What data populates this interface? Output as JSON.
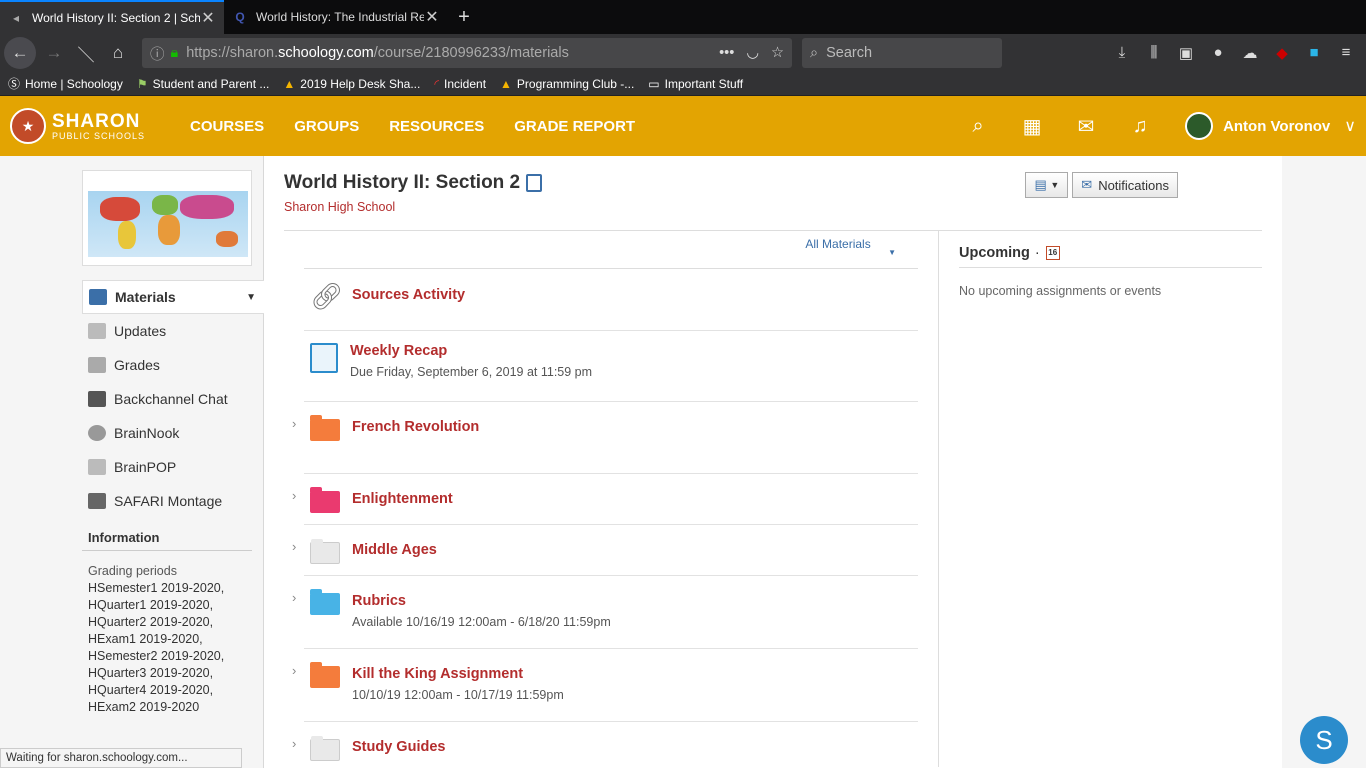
{
  "browser": {
    "tabs": [
      {
        "title": "World History II: Section 2 | Sch",
        "active": true
      },
      {
        "title": "World History: The Industrial Re",
        "active": false
      }
    ],
    "url_prefix": "https://sharon.",
    "url_domain": "schoology.com",
    "url_path": "/course/2180996233/materials",
    "search_placeholder": "Search",
    "bookmarks": [
      {
        "label": "Home | Schoology",
        "icon": "schoology-icon"
      },
      {
        "label": "Student and Parent ...",
        "icon": "flag-icon"
      },
      {
        "label": "2019 Help Desk Sha...",
        "icon": "drive-icon"
      },
      {
        "label": "Incident",
        "icon": "incident-icon"
      },
      {
        "label": "Programming Club -...",
        "icon": "drive-icon"
      },
      {
        "label": "Important Stuff",
        "icon": "folder-icon"
      }
    ]
  },
  "header": {
    "logo_line1": "SHARON",
    "logo_line2": "PUBLIC SCHOOLS",
    "nav": [
      "COURSES",
      "GROUPS",
      "RESOURCES",
      "GRADE REPORT"
    ],
    "user_name": "Anton Voronov",
    "bg_color": "#e3a402"
  },
  "sidebar": {
    "items": [
      {
        "label": "Materials",
        "active": true
      },
      {
        "label": "Updates"
      },
      {
        "label": "Grades"
      },
      {
        "label": "Backchannel Chat"
      },
      {
        "label": "BrainNook"
      },
      {
        "label": "BrainPOP"
      },
      {
        "label": "SAFARI Montage"
      }
    ],
    "info_heading": "Information",
    "grading_label": "Grading periods",
    "grading_periods": "HSemester1 2019-2020, HQuarter1 2019-2020, HQuarter2 2019-2020, HExam1 2019-2020, HSemester2 2019-2020, HQuarter3 2019-2020, HQuarter4 2019-2020, HExam2 2019-2020"
  },
  "course": {
    "title": "World History II: Section 2",
    "school": "Sharon High School",
    "notifications_label": "Notifications"
  },
  "materials": {
    "filter_label": "All Materials",
    "items": [
      {
        "name": "Sources Activity",
        "type": "link",
        "sub": ""
      },
      {
        "name": "Weekly Recap",
        "type": "assignment",
        "sub": "Due Friday, September 6, 2019 at 11:59 pm"
      },
      {
        "name": "French Revolution",
        "type": "folder",
        "color": "#f47c3c",
        "sub": ""
      },
      {
        "name": "Enlightenment",
        "type": "folder",
        "color": "#ea3a6f",
        "sub": ""
      },
      {
        "name": "Middle Ages",
        "type": "folder",
        "color": "#e9e9e9",
        "sub": ""
      },
      {
        "name": "Rubrics",
        "type": "folder",
        "color": "#48b3e6",
        "sub": "Available 10/16/19 12:00am - 6/18/20 11:59pm"
      },
      {
        "name": "Kill the King Assignment",
        "type": "folder",
        "color": "#f47c3c",
        "sub": "10/10/19 12:00am - 10/17/19 11:59pm"
      },
      {
        "name": "Study Guides",
        "type": "folder",
        "color": "#e9e9e9",
        "sub": ""
      }
    ]
  },
  "upcoming": {
    "heading": "Upcoming",
    "calendar_day": "16",
    "empty_text": "No upcoming assignments or events"
  },
  "status_text": "Waiting for sharon.schoology.com...",
  "chat_icon_letter": "S"
}
